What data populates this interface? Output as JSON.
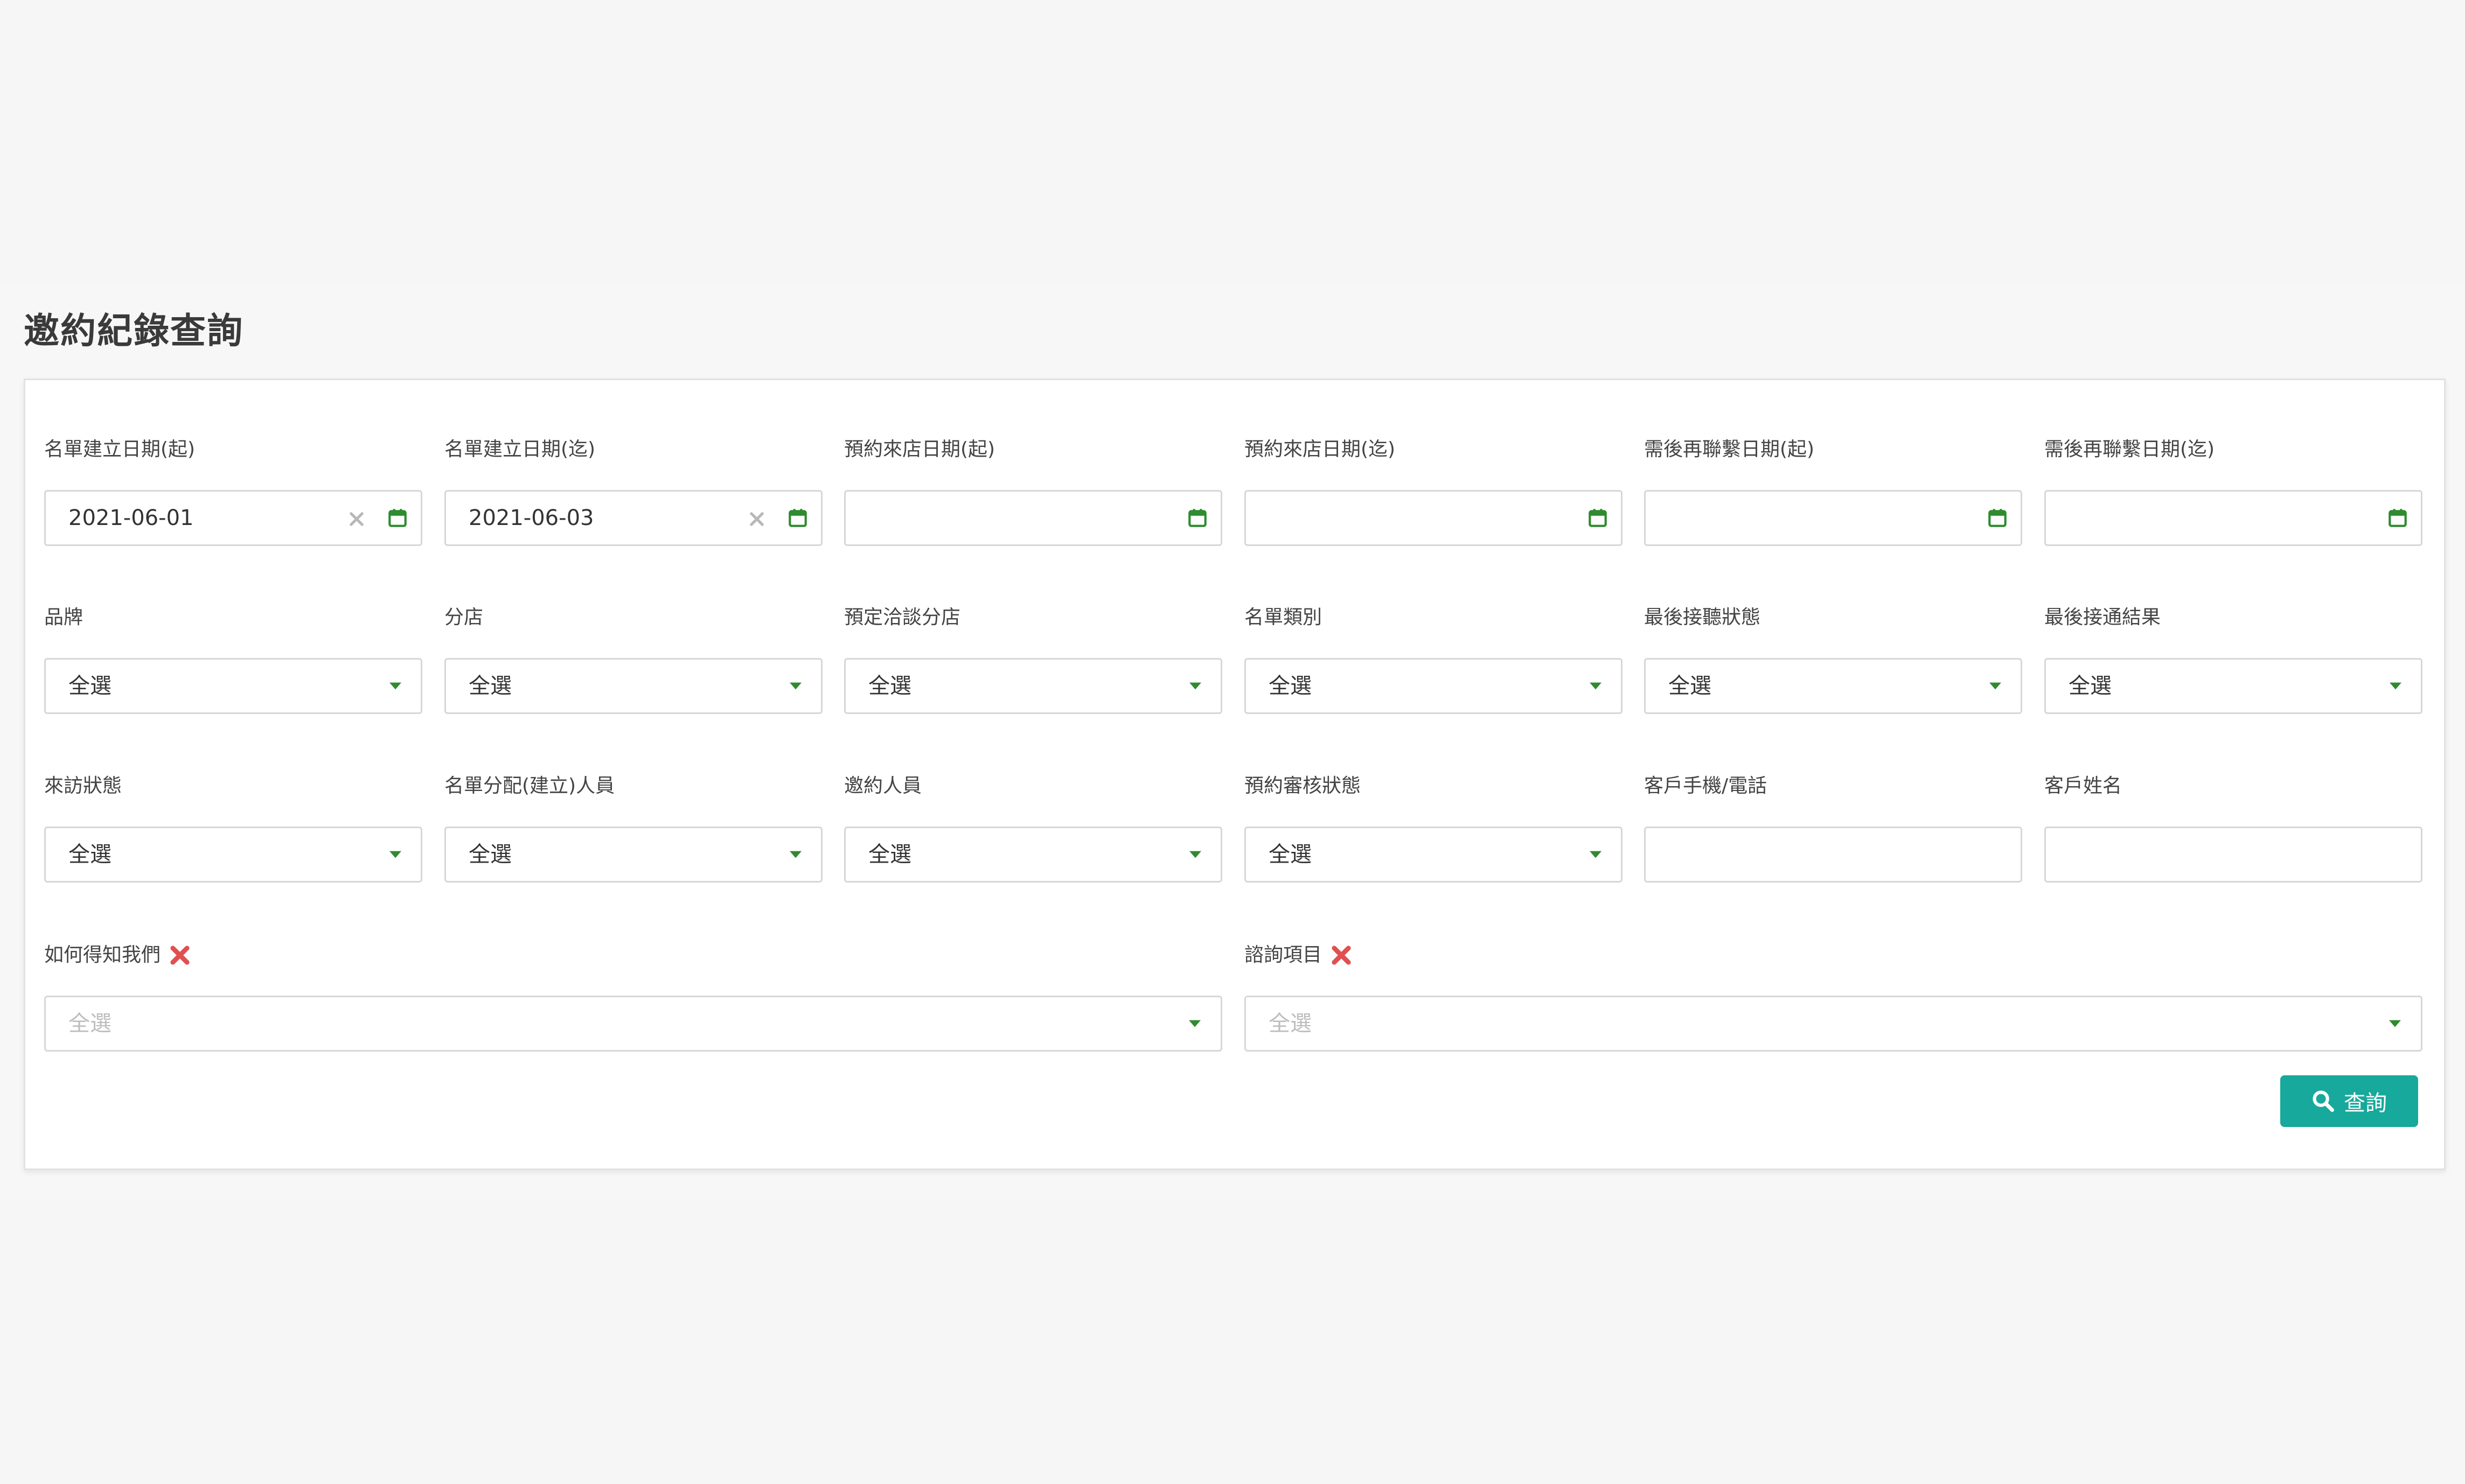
{
  "page": {
    "title": "邀約紀錄查詢"
  },
  "colors": {
    "accent": "#17a99b",
    "calendar_icon": "#2e8b2e",
    "caret": "#2e8b2e",
    "remove_icon": "#e05050",
    "border": "#d7d7d7"
  },
  "form": {
    "row1": [
      {
        "label": "名單建立日期(起)",
        "value": "2021-06-01"
      },
      {
        "label": "名單建立日期(迄)",
        "value": "2021-06-03"
      },
      {
        "label": "預約來店日期(起)",
        "value": ""
      },
      {
        "label": "預約來店日期(迄)",
        "value": ""
      },
      {
        "label": "需後再聯繫日期(起)",
        "value": ""
      },
      {
        "label": "需後再聯繫日期(迄)",
        "value": ""
      }
    ],
    "row2": [
      {
        "label": "品牌",
        "value": "全選"
      },
      {
        "label": "分店",
        "value": "全選"
      },
      {
        "label": "預定洽談分店",
        "value": "全選"
      },
      {
        "label": "名單類別",
        "value": "全選"
      },
      {
        "label": "最後接聽狀態",
        "value": "全選"
      },
      {
        "label": "最後接通結果",
        "value": "全選"
      }
    ],
    "row3": [
      {
        "label": "來訪狀態",
        "value": "全選"
      },
      {
        "label": "名單分配(建立)人員",
        "value": "全選"
      },
      {
        "label": "邀約人員",
        "value": "全選"
      },
      {
        "label": "預約審核狀態",
        "value": "全選"
      },
      {
        "label": "客戶手機/電話",
        "value": ""
      },
      {
        "label": "客戶姓名",
        "value": ""
      }
    ],
    "row4": [
      {
        "label": "如何得知我們",
        "placeholder": "全選"
      },
      {
        "label": "諮詢項目",
        "placeholder": "全選"
      }
    ]
  },
  "actions": {
    "search_label": "查詢"
  }
}
